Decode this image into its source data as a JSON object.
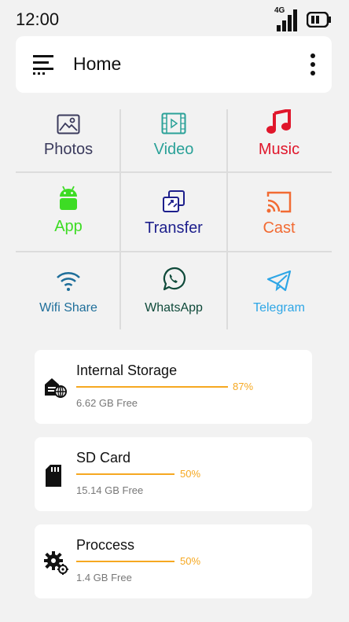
{
  "status": {
    "time": "12:00",
    "network": "4G"
  },
  "appbar": {
    "title": "Home"
  },
  "tiles": [
    {
      "label": "Photos",
      "color": "#3a3a5c",
      "icon": "image-icon"
    },
    {
      "label": "Video",
      "color": "#2aa198",
      "icon": "film-icon"
    },
    {
      "label": "Music",
      "color": "#e0162b",
      "icon": "music-note-icon"
    },
    {
      "label": "App",
      "color": "#3ddc24",
      "icon": "android-icon"
    },
    {
      "label": "Transfer",
      "color": "#1d1f8c",
      "icon": "transfer-icon"
    },
    {
      "label": "Cast",
      "color": "#f26b33",
      "icon": "cast-icon"
    },
    {
      "label": "Wifi Share",
      "color": "#1e6e9a",
      "icon": "wifi-icon"
    },
    {
      "label": "WhatsApp",
      "color": "#0f4a3a",
      "icon": "whatsapp-icon"
    },
    {
      "label": "Telegram",
      "color": "#2ea6e6",
      "icon": "telegram-icon"
    }
  ],
  "storage": [
    {
      "name": "Internal Storage",
      "percent_label": "87%",
      "percent": 87,
      "free": "6.62 GB Free",
      "icon": "storage-icon"
    },
    {
      "name": "SD Card",
      "percent_label": "50%",
      "percent": 50,
      "free": "15.14 GB Free",
      "icon": "sd-card-icon"
    },
    {
      "name": "Proccess",
      "percent_label": "50%",
      "percent": 50,
      "free": "1.4 GB Free",
      "icon": "gears-icon"
    }
  ],
  "colors": {
    "accent": "#f6a821",
    "background": "#f2f2f2"
  }
}
